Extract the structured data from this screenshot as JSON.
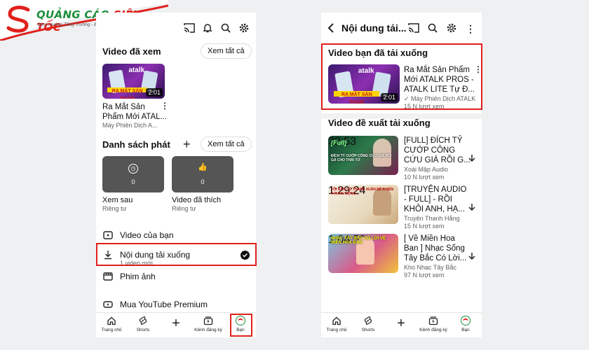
{
  "logo": {
    "brand_green": "QUẢNG CÁO",
    "brand_red": "SIÊU TỐC",
    "tagline": "Định Hướng Tăng Trưởng - Đồng Hành Thành Công"
  },
  "colors": {
    "accent_red": "#e0201b",
    "brand_green": "#1d8f3a"
  },
  "left": {
    "history": {
      "title": "Video đã xem",
      "see_all": "Xem tất cả",
      "video": {
        "duration": "2:01",
        "title_line1": "Ra Mắt Sản",
        "title_line2": "Phẩm Mới ATAL...",
        "channel": "Máy Phiên Dịch A...",
        "thumb_word": "atalk",
        "thumb_band": "RA MẮT SẢN PHẨM"
      }
    },
    "playlists": {
      "title": "Danh sách phát",
      "see_all": "Xem tất cả",
      "items": [
        {
          "count": "0",
          "title": "Xem sau",
          "privacy": "Riêng tư",
          "icon": "clock-icon"
        },
        {
          "count": "0",
          "title": "Video đã thích",
          "privacy": "Riêng tư",
          "icon": "thumbs-up-icon"
        }
      ]
    },
    "menu": {
      "your_videos": "Video của bạn",
      "downloads": "Nội dung tải xuống",
      "downloads_sub": "1 video mới",
      "movies": "Phim ảnh",
      "premium": "Mua YouTube Premium"
    }
  },
  "nav": {
    "home": "Trang chủ",
    "shorts": "Shorts",
    "subs": "Kênh đăng ký",
    "you": "Bạn"
  },
  "right": {
    "header_title": "Nội dung tải...",
    "downloaded_title": "Video bạn đã tải xuống",
    "downloaded_video": {
      "duration": "2:01",
      "title_line1": "Ra Mắt Sản Phẩm",
      "title_line2": "Mới ATALK PROS -",
      "title_line3": "ATALK LITE Tự Đ...",
      "channel": "Máy Phiên Dịch ATALK",
      "views": "15 N lượt xem",
      "thumb_word": "atalk",
      "thumb_band": "RA MẮT SẢN PHẨM"
    },
    "suggested_title": "Video đề xuất tải xuống",
    "suggested": [
      {
        "duration": "32:53",
        "line1": "[FULL] ĐÍCH TỶ",
        "line2": "CƯỚP CÔNG",
        "line3": "CỨU GIÁ RỒI G...",
        "channel": "Xoài Mập Audio",
        "views": "10 N lượt xem",
        "thumb_label": "[Full]",
        "caption": "ĐÍCH TỶ CƯỚP CÔNG CỨU GIÁ RỒI GẢ CHO THÁI TỬ"
      },
      {
        "duration": "1:29:24",
        "line1": "[TRUYỆN AUDIO",
        "line2": "- FULL] - RỒI",
        "line3": "KHỎI ANH, HẠ...",
        "channel": "Truyện Thanh Hằng",
        "views": "15 N lượt xem",
        "caption": "TÔI BÁN CỔ THANH XUÂN ĐỂ KHIẾN 4 RUNG ĐỘNG..."
      },
      {
        "duration": "1:04:59",
        "line1": "[ Về Miền Hoa",
        "line2": "Ban ] Nhạc Sống",
        "line3": "Tây Bắc Có Lời...",
        "channel": "Kho Nhạc Tây Bắc",
        "views": "97 N lượt xem",
        "caption": "NHẠC TÂY BẮC CÓ LỜI VỀ MIỀN HOA BAN"
      }
    ]
  }
}
